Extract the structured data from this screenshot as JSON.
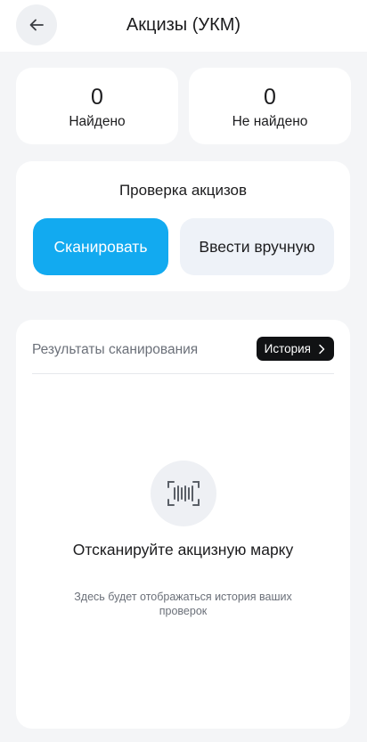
{
  "header": {
    "title": "Акцизы (УКМ)",
    "back_icon": "arrow-left-icon"
  },
  "stats": {
    "found_value": "0",
    "found_label": "Найдено",
    "not_found_value": "0",
    "not_found_label": "Не найдено"
  },
  "check": {
    "title": "Проверка акцизов",
    "scan_label": "Сканировать",
    "manual_label": "Ввести вручную"
  },
  "results": {
    "title": "Результаты сканирования",
    "history_label": "История",
    "history_icon": "chevron-right-icon",
    "empty_icon": "barcode-scan-icon",
    "empty_title": "Отсканируйте акцизную марку",
    "empty_subtitle": "Здесь будет отображаться история ваших проверок"
  },
  "colors": {
    "accent": "#12aaf0",
    "background": "#f4f5f7",
    "history_button": "#111214"
  }
}
